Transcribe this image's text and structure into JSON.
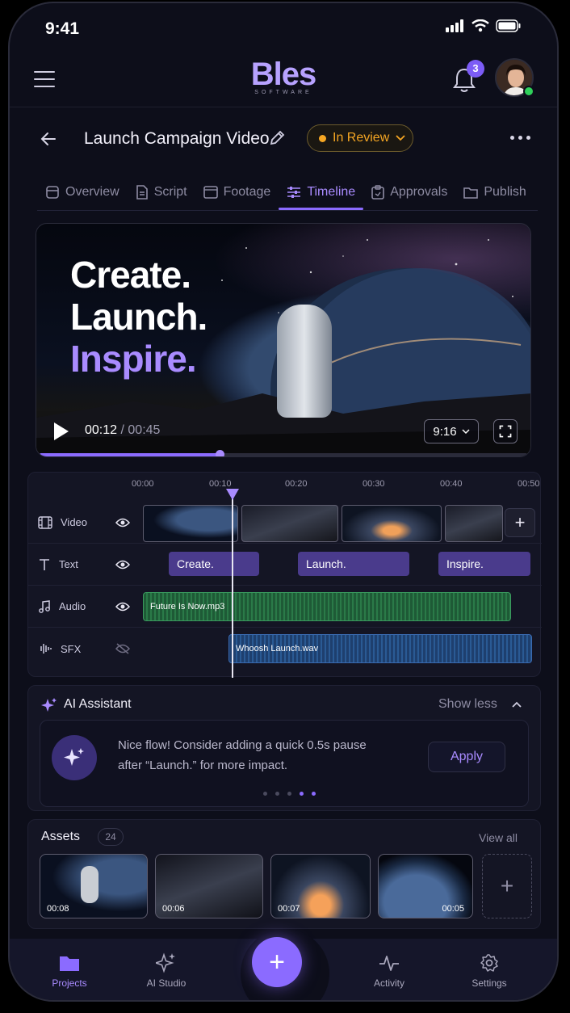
{
  "status_bar": {
    "time": "9:41"
  },
  "header": {
    "logo_word": "Bles",
    "logo_sub": "SOFTWARE",
    "notifications_count": "3"
  },
  "project": {
    "title": "Launch Campaign Video",
    "status": "In Review",
    "status_color": "#f5a623"
  },
  "tabs": [
    {
      "label": "Overview",
      "icon": "overview-icon"
    },
    {
      "label": "Script",
      "icon": "document-icon"
    },
    {
      "label": "Footage",
      "icon": "image-icon"
    },
    {
      "label": "Timeline",
      "icon": "sliders-icon",
      "active": true
    },
    {
      "label": "Approvals",
      "icon": "clipboard-check-icon"
    },
    {
      "label": "Publish",
      "icon": "folder-icon"
    }
  ],
  "preview": {
    "headline_1": "Create.",
    "headline_2": "Launch.",
    "headline_3": "Inspire.",
    "current_time": "00:12",
    "separator": " / ",
    "total_time": "00:45",
    "progress": 0.37,
    "aspect_ratio": "9:16"
  },
  "timeline": {
    "ruler": [
      "00:00",
      "00:10",
      "00:20",
      "00:30",
      "00:40",
      "00:50"
    ],
    "tracks": [
      {
        "label": "Video",
        "icon": "film-icon",
        "visible": true
      },
      {
        "label": "Text",
        "icon": "text-icon",
        "visible": true
      },
      {
        "label": "Audio",
        "icon": "music-note-icon",
        "visible": true
      },
      {
        "label": "SFX",
        "icon": "waveform-icon",
        "visible": false
      }
    ],
    "text_clips": [
      "Create.",
      "Launch.",
      "Inspire."
    ],
    "audio_clip": "Future Is Now.mp3",
    "sfx_clip": "Whoosh Launch.wav",
    "add_label": "+"
  },
  "ai_assistant": {
    "title": "AI Assistant",
    "toggle_label": "Show less",
    "message": "Nice flow! Consider adding a quick 0.5s pause after “Launch.” for more impact.",
    "action_label": "Apply",
    "pager_total": 5,
    "pager_active": 3
  },
  "assets": {
    "title": "Assets",
    "count": "24",
    "view_all": "View all",
    "items": [
      {
        "duration": "00:08"
      },
      {
        "duration": "00:06"
      },
      {
        "duration": "00:07"
      },
      {
        "duration": "00:05"
      }
    ],
    "add_label": "+"
  },
  "nav": {
    "items": [
      {
        "label": "Projects",
        "icon": "folder-icon",
        "active": true
      },
      {
        "label": "AI Studio",
        "icon": "sparkles-icon"
      },
      {
        "label": "Activity",
        "icon": "activity-icon"
      },
      {
        "label": "Settings",
        "icon": "gear-icon"
      }
    ],
    "fab_label": "+"
  },
  "colors": {
    "accent": "#8b6bff",
    "background": "#0d0e1a",
    "status_warning": "#f5a623",
    "online": "#2fd05a"
  }
}
